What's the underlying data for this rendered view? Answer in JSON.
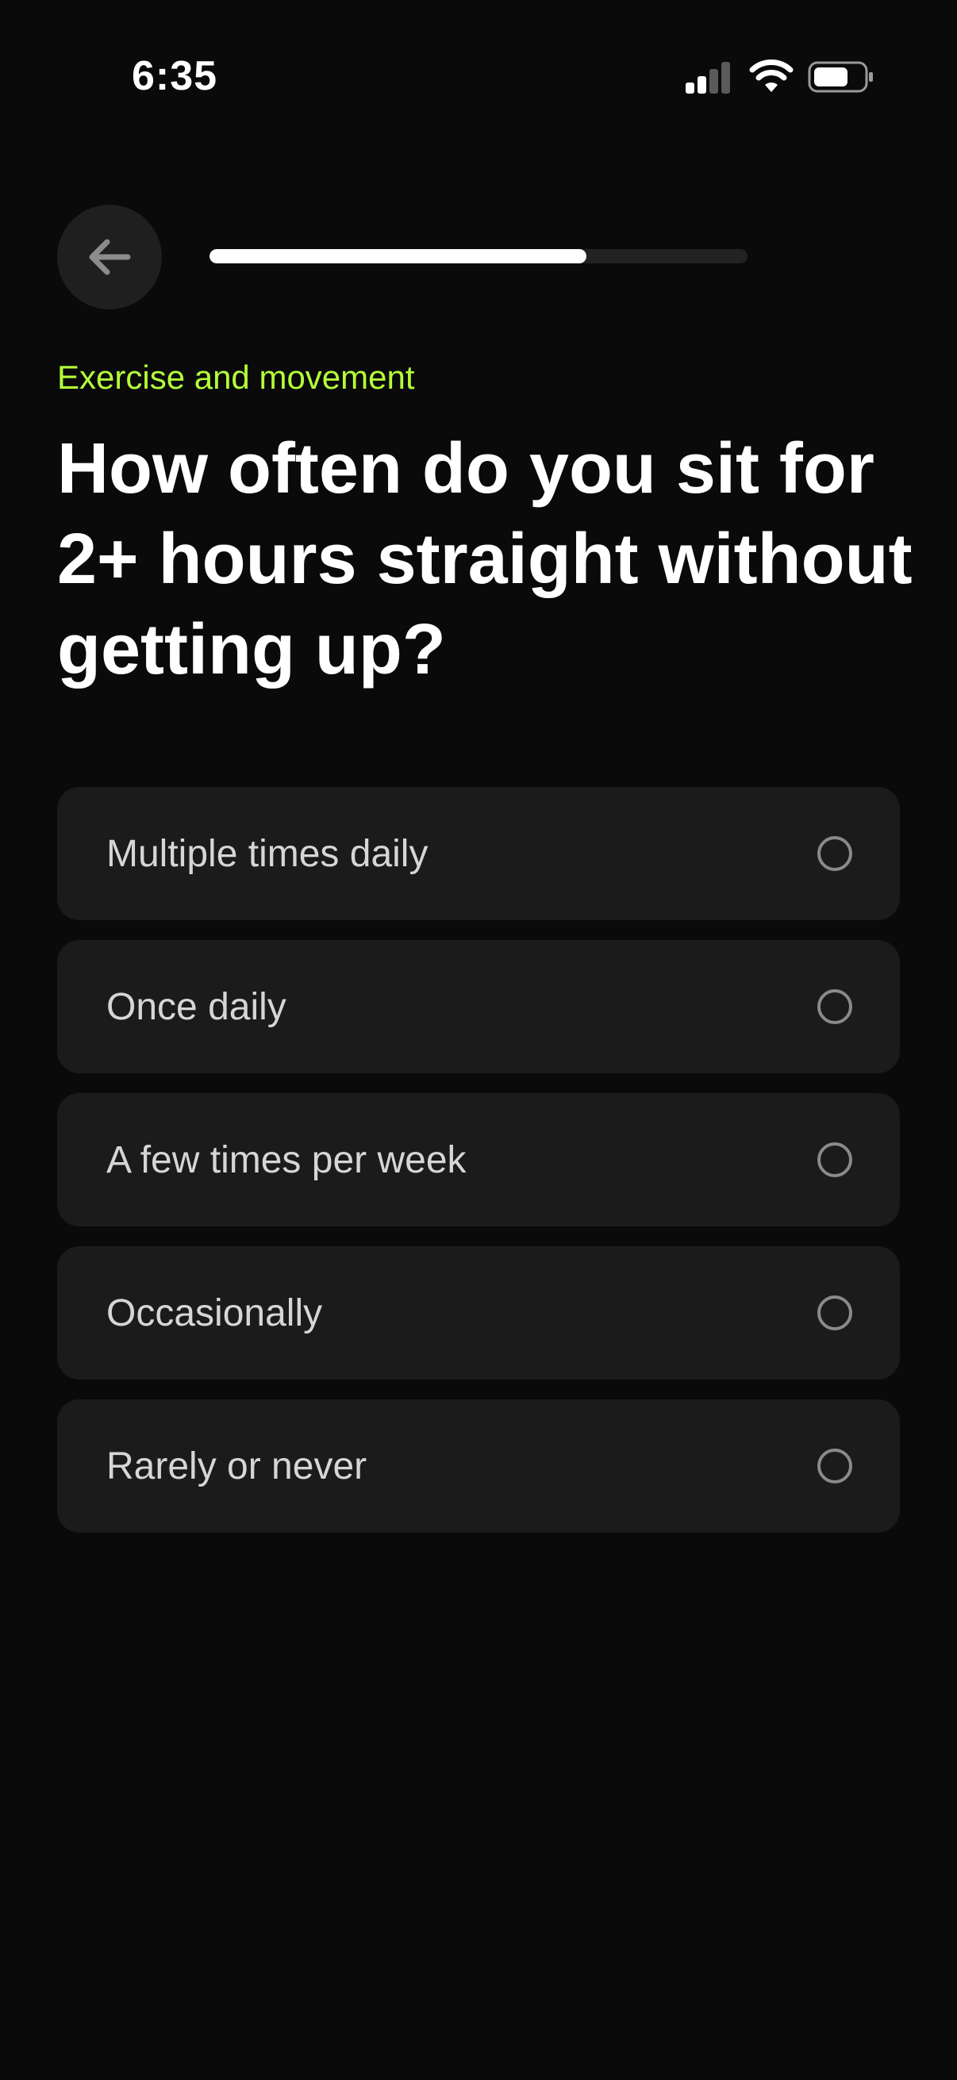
{
  "status_bar": {
    "time": "6:35"
  },
  "header": {
    "back_icon": "arrow-left-icon",
    "progress": 0.7
  },
  "question": {
    "category": "Exercise and movement",
    "text": "How often do you sit for 2+ hours straight without getting up?"
  },
  "options": [
    {
      "label": "Multiple times daily"
    },
    {
      "label": "Once daily"
    },
    {
      "label": "A few times per week"
    },
    {
      "label": "Occasionally"
    },
    {
      "label": "Rarely or never"
    }
  ],
  "colors": {
    "background": "#0a0a0a",
    "accent": "#b4ff39",
    "option_bg": "#1b1b1b",
    "progress_fill": "#ffffff"
  }
}
